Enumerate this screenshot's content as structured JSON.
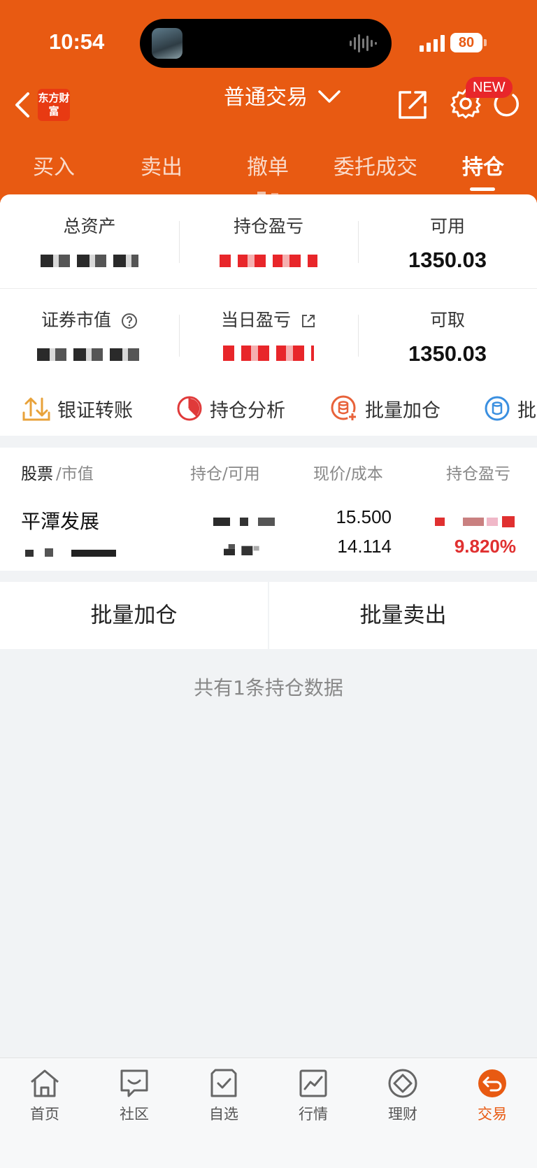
{
  "status_bar": {
    "time": "10:54",
    "battery": "80"
  },
  "header": {
    "title": "普通交易",
    "badge": "NEW",
    "brand_logo": "东方财富"
  },
  "tabs": [
    {
      "label": "买入"
    },
    {
      "label": "卖出"
    },
    {
      "label": "撤单"
    },
    {
      "label": "委托成交"
    },
    {
      "label": "持仓",
      "active": true
    }
  ],
  "summary": {
    "total_assets_label": "总资产",
    "position_pnl_label": "持仓盈亏",
    "available_label": "可用",
    "available_value": "1350.03",
    "market_value_label": "证券市值",
    "daily_pnl_label": "当日盈亏",
    "withdrawable_label": "可取",
    "withdrawable_value": "1350.03"
  },
  "shortcuts": [
    {
      "label": "银证转账",
      "icon": "transfer-icon",
      "color": "#e8a23a"
    },
    {
      "label": "持仓分析",
      "icon": "pie-chart-icon",
      "color": "#e03a3a"
    },
    {
      "label": "批量加仓",
      "icon": "batch-add-icon",
      "color": "#e8623a"
    },
    {
      "label": "批量",
      "icon": "batch-icon",
      "color": "#3a8fe0"
    }
  ],
  "positions": {
    "headers": {
      "stock": "股票",
      "market_value": "/市值",
      "holding": "持仓/可用",
      "price": "现价/成本",
      "pnl": "持仓盈亏"
    },
    "rows": [
      {
        "name": "平潭发展",
        "price": "15.500",
        "cost": "14.114",
        "pnl_percent": "9.820%"
      }
    ]
  },
  "batch_actions": {
    "add": "批量加仓",
    "sell": "批量卖出"
  },
  "count_note": "共有1条持仓数据",
  "bottom_nav": [
    {
      "label": "首页",
      "icon": "home-icon"
    },
    {
      "label": "社区",
      "icon": "community-icon"
    },
    {
      "label": "自选",
      "icon": "watchlist-icon"
    },
    {
      "label": "行情",
      "icon": "market-icon"
    },
    {
      "label": "理财",
      "icon": "wealth-icon"
    },
    {
      "label": "交易",
      "icon": "trade-icon",
      "active": true
    }
  ],
  "colors": {
    "brand": "#e85a12",
    "gain": "#e03030"
  }
}
